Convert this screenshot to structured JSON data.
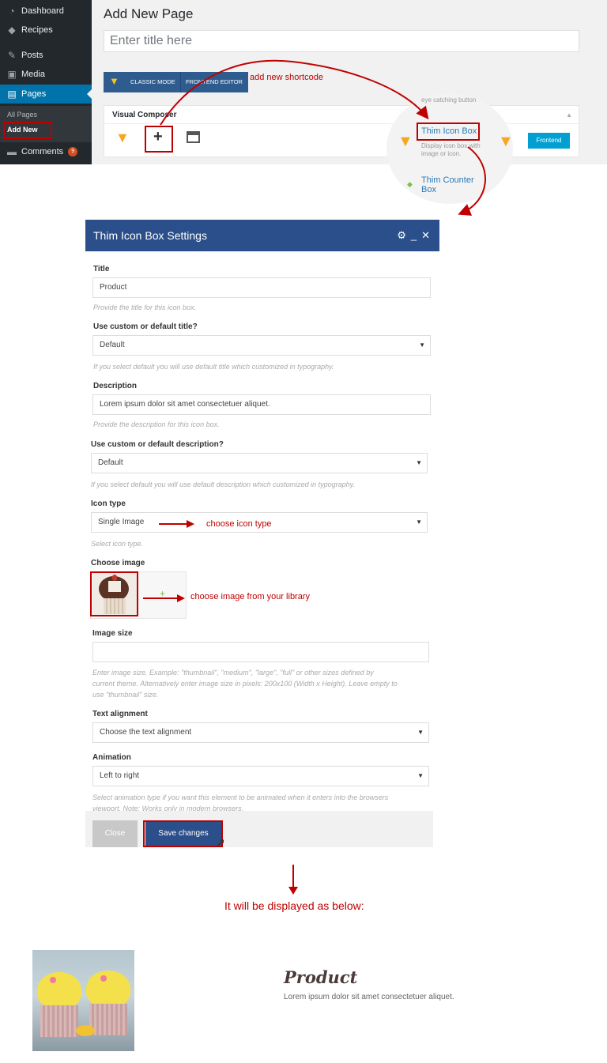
{
  "sidebar": {
    "items": [
      {
        "label": "Dashboard",
        "icon": "dashboard-icon"
      },
      {
        "label": "Recipes",
        "icon": "tag-icon"
      },
      {
        "label": "Posts",
        "icon": "pin-icon"
      },
      {
        "label": "Media",
        "icon": "media-icon"
      },
      {
        "label": "Pages",
        "icon": "pages-icon"
      },
      {
        "label": "Comments",
        "icon": "comments-icon"
      }
    ],
    "submenu": [
      "All Pages",
      "Add New"
    ],
    "comment_count": "9"
  },
  "editor": {
    "page_title": "Add New Page",
    "title_placeholder": "Enter title here",
    "classic_mode_label": "CLASSIC MODE",
    "frontend_editor_label": "FRONTEND EDITOR",
    "visual_composer_label": "Visual Composer",
    "frontend_button": "Frontend"
  },
  "annotations": {
    "add_shortcode": "add new shortcode",
    "choose_icon_type": "choose icon type",
    "choose_image": "choose image from your library",
    "display_below": "It will be displayed as below:"
  },
  "elements_popup": {
    "eye_catching": "eye catching button",
    "icon_box_title": "Thim Icon Box",
    "icon_box_desc_1": "Display icon box with",
    "icon_box_desc_2": "image or icon.",
    "counter_box_title_1": "Thim Counter",
    "counter_box_title_2": "Box"
  },
  "dialog": {
    "title": "Thim Icon Box Settings",
    "fields": {
      "title_label": "Title",
      "title_value": "Product",
      "title_hint": "Provide the title for this icon box.",
      "custom_title_label": "Use custom or default title?",
      "custom_title_value": "Default",
      "custom_title_hint": "If you select default you will use default title which customized in typography.",
      "description_label": "Description",
      "description_value": "Lorem ipsum dolor sit amet consectetuer aliquet.",
      "description_hint": "Provide the description for this icon box.",
      "custom_desc_label": "Use custom or default description?",
      "custom_desc_value": "Default",
      "custom_desc_hint": "If you select default you will use default description which customized in typography.",
      "icon_type_label": "Icon type",
      "icon_type_value": "Single Image",
      "icon_type_hint": "Select icon type.",
      "choose_image_label": "Choose image",
      "image_size_label": "Image size",
      "image_size_hint_1": "Enter image size. Example: \"thumbnail\", \"medium\", \"large\", \"full\" or other sizes defined by",
      "image_size_hint_2": "current theme. Alternatively enter image size in pixels: 200x100 (Width x Height). Leave empty to",
      "image_size_hint_3": "use \"thumbnail\" size.",
      "text_alignment_label": "Text alignment",
      "text_alignment_value": "Choose the text alignment",
      "animation_label": "Animation",
      "animation_value": "Left to right",
      "animation_hint_1": "Select animation type if you want this element to be animated when it enters into the browsers",
      "animation_hint_2": "viewport. Note: Works only in modern browsers."
    },
    "close_button": "Close",
    "save_button": "Save changes"
  },
  "result": {
    "title": "Product",
    "description": "Lorem ipsum dolor sit amet consectetuer aliquet."
  }
}
